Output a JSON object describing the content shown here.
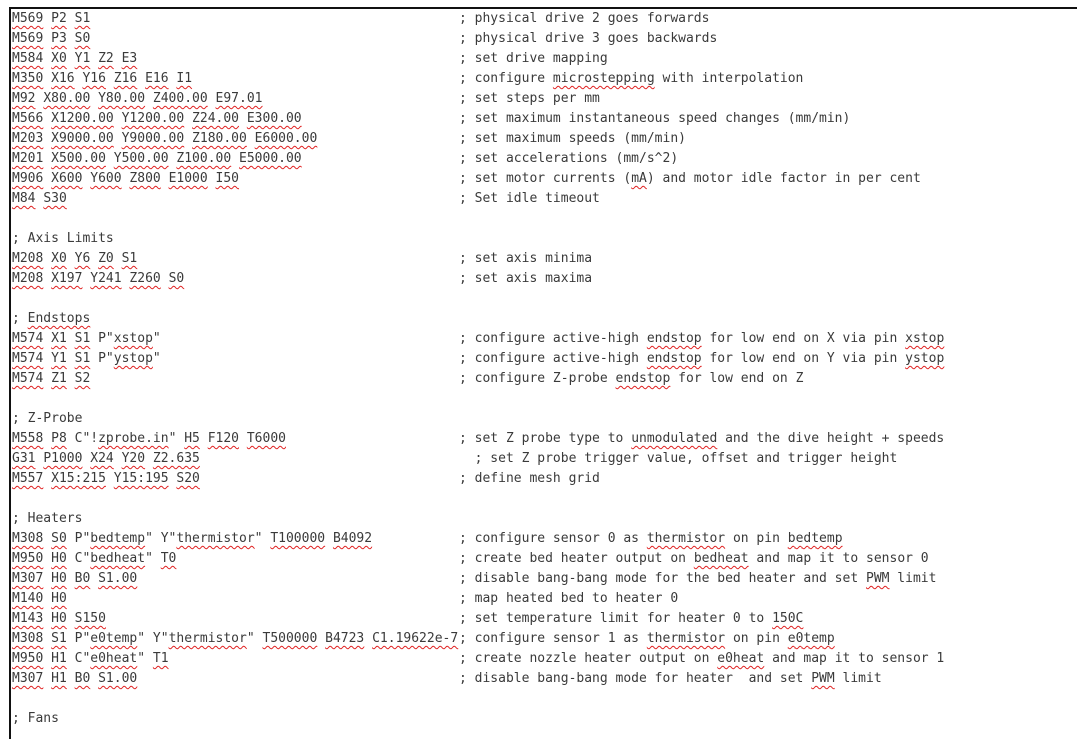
{
  "spellcheck_color": "#e02020",
  "flagged_words": [
    "microstepping",
    "mA",
    "Endstops",
    "endstop",
    "xstop",
    "ystop",
    "unmodulated",
    "thermistor",
    "bedtemp",
    "bedheat",
    "PWM",
    "150C",
    "e0temp",
    "e0heat",
    "zprobe.in"
  ],
  "lines": [
    {
      "code": "M569 P2 S1",
      "comment": "; physical drive 2 goes forwards"
    },
    {
      "code": "M569 P3 S0",
      "comment": "; physical drive 3 goes backwards"
    },
    {
      "code": "M584 X0 Y1 Z2 E3",
      "comment": "; set drive mapping"
    },
    {
      "code": "M350 X16 Y16 Z16 E16 I1",
      "comment": "; configure microstepping with interpolation"
    },
    {
      "code": "M92 X80.00 Y80.00 Z400.00 E97.01",
      "comment": "; set steps per mm"
    },
    {
      "code": "M566 X1200.00 Y1200.00 Z24.00 E300.00",
      "comment": "; set maximum instantaneous speed changes (mm/min)"
    },
    {
      "code": "M203 X9000.00 Y9000.00 Z180.00 E6000.00",
      "comment": "; set maximum speeds (mm/min)"
    },
    {
      "code": "M201 X500.00 Y500.00 Z100.00 E5000.00",
      "comment": "; set accelerations (mm/s^2)"
    },
    {
      "code": "M906 X600 Y600 Z800 E1000 I50",
      "comment": "; set motor currents (mA) and motor idle factor in per cent"
    },
    {
      "code": "M84 S30",
      "comment": "; Set idle timeout"
    },
    {
      "code": "",
      "comment": ""
    },
    {
      "code": "; Axis Limits",
      "comment": ""
    },
    {
      "code": "M208 X0 Y6 Z0 S1",
      "comment": "; set axis minima"
    },
    {
      "code": "M208 X197 Y241 Z260 S0",
      "comment": "; set axis maxima"
    },
    {
      "code": "",
      "comment": ""
    },
    {
      "code": "; Endstops",
      "comment": ""
    },
    {
      "code": "M574 X1 S1 P\"xstop\"",
      "comment": "; configure active-high endstop for low end on X via pin xstop"
    },
    {
      "code": "M574 Y1 S1 P\"ystop\"",
      "comment": "; configure active-high endstop for low end on Y via pin ystop"
    },
    {
      "code": "M574 Z1 S2",
      "comment": "; configure Z-probe endstop for low end on Z"
    },
    {
      "code": "",
      "comment": ""
    },
    {
      "code": "; Z-Probe",
      "comment": ""
    },
    {
      "code": "M558 P8 C\"!zprobe.in\" H5 F120 T6000",
      "comment": "; set Z probe type to unmodulated and the dive height + speeds"
    },
    {
      "code": "G31 P1000 X24 Y20 Z2.635",
      "comment": "  ; set Z probe trigger value, offset and trigger height"
    },
    {
      "code": "M557 X15:215 Y15:195 S20",
      "comment": "; define mesh grid"
    },
    {
      "code": "",
      "comment": ""
    },
    {
      "code": "; Heaters",
      "comment": ""
    },
    {
      "code": "M308 S0 P\"bedtemp\" Y\"thermistor\" T100000 B4092",
      "comment": "; configure sensor 0 as thermistor on pin bedtemp"
    },
    {
      "code": "M950 H0 C\"bedheat\" T0",
      "comment": "; create bed heater output on bedheat and map it to sensor 0"
    },
    {
      "code": "M307 H0 B0 S1.00",
      "comment": "; disable bang-bang mode for the bed heater and set PWM limit"
    },
    {
      "code": "M140 H0",
      "comment": "; map heated bed to heater 0"
    },
    {
      "code": "M143 H0 S150",
      "comment": "; set temperature limit for heater 0 to 150C"
    },
    {
      "code": "M308 S1 P\"e0temp\" Y\"thermistor\" T500000 B4723 C1.19622e-7",
      "comment": "; configure sensor 1 as thermistor on pin e0temp"
    },
    {
      "code": "M950 H1 C\"e0heat\" T1",
      "comment": "; create nozzle heater output on e0heat and map it to sensor 1"
    },
    {
      "code": "M307 H1 B0 S1.00",
      "comment": "; disable bang-bang mode for heater  and set PWM limit"
    },
    {
      "code": "",
      "comment": ""
    },
    {
      "code": "; Fans",
      "comment": ""
    }
  ]
}
